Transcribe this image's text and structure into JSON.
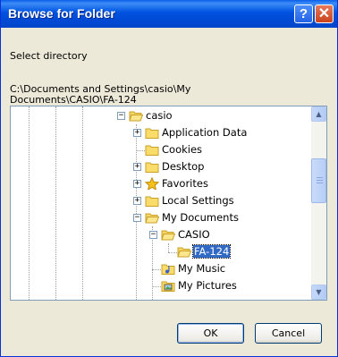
{
  "window": {
    "title": "Browse for Folder"
  },
  "titlebar": {
    "help_glyph": "?",
    "close_glyph": "✕"
  },
  "dialog": {
    "description": "Select directory",
    "path_line1": "C:\\Documents and Settings\\casio\\My",
    "path_line2": "Documents\\CASIO\\FA-124"
  },
  "tree": {
    "nodes": [
      {
        "label": "casio",
        "icon": "folder-open-icon",
        "expander": "−",
        "level": 0
      },
      {
        "label": "Application Data",
        "icon": "folder-icon",
        "expander": "+",
        "level": 1
      },
      {
        "label": "Cookies",
        "icon": "folder-icon",
        "expander": "",
        "level": 1
      },
      {
        "label": "Desktop",
        "icon": "folder-icon",
        "expander": "+",
        "level": 1
      },
      {
        "label": "Favorites",
        "icon": "favorites-star-icon",
        "expander": "+",
        "level": 1
      },
      {
        "label": "Local Settings",
        "icon": "folder-icon",
        "expander": "+",
        "level": 1
      },
      {
        "label": "My Documents",
        "icon": "folder-open-icon",
        "expander": "−",
        "level": 1
      },
      {
        "label": "CASIO",
        "icon": "folder-open-icon",
        "expander": "−",
        "level": 2
      },
      {
        "label": "FA-124",
        "icon": "folder-open-icon",
        "expander": "",
        "level": 3,
        "selected": true
      },
      {
        "label": "My Music",
        "icon": "music-folder-icon",
        "expander": "",
        "level": 2
      },
      {
        "label": "My Pictures",
        "icon": "pictures-folder-icon",
        "expander": "",
        "level": 2
      }
    ],
    "scrollbar": {
      "up_glyph": "▲",
      "down_glyph": "▼"
    }
  },
  "buttons": {
    "ok": "OK",
    "cancel": "Cancel"
  },
  "colors": {
    "titlebar": "#0054e3",
    "selection": "#316ac5",
    "dialog_bg": "#ece9d8"
  }
}
